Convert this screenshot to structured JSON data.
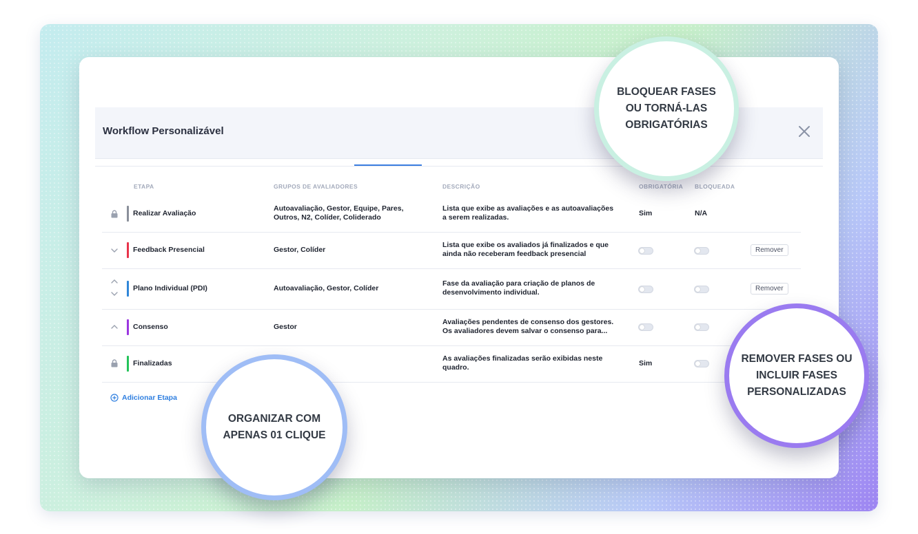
{
  "modal": {
    "title": "Workflow Personalizável"
  },
  "columns": {
    "stage": "ETAPA",
    "groups": "GRUPOS DE AVALIADORES",
    "description": "DESCRIÇÃO",
    "required": "OBRIGATÓRIA",
    "blocked": "BLOQUEADA"
  },
  "rows": [
    {
      "stage": "Realizar Avaliação",
      "groups_1": "Autoavaliação, Gestor, Equipe, Pares,",
      "groups_2": "Outros, N2, Colíder, Coliderado",
      "desc_1": "Lista que exibe as avaliações e as autoavaliações",
      "desc_2": "a serem realizadas.",
      "required": "Sim",
      "blocked": "N/A",
      "color": "#8a8f9a"
    },
    {
      "stage": "Feedback Presencial",
      "groups_1": "Gestor, Colíder",
      "desc_1": "Lista que exibe os avaliados já finalizados e que",
      "desc_2": "ainda não receberam feedback presencial",
      "remove": "Remover",
      "color": "#e8334a"
    },
    {
      "stage": "Plano Individual (PDI)",
      "groups_1": "Autoavaliação, Gestor, Colíder",
      "desc_1": "Fase da avaliação para criação de planos de",
      "desc_2": "desenvolvimento individual.",
      "remove": "Remover",
      "color": "#2f86d8"
    },
    {
      "stage": "Consenso",
      "groups_1": "Gestor",
      "desc_1": "Avaliações pendentes de consenso dos gestores.",
      "desc_2": "Os avaliadores devem salvar o consenso para...",
      "color": "#9b36e0"
    },
    {
      "stage": "Finalizadas",
      "desc_1": "As avaliações finalizadas serão exibidas neste",
      "desc_2": "quadro.",
      "required": "Sim",
      "color": "#24c35a"
    }
  ],
  "add_stage": "Adicionar Etapa",
  "bubbles": {
    "lock": [
      "BLOQUEAR FASES",
      "OU TORNÁ-LAS",
      "OBRIGATÓRIAS"
    ],
    "organize": [
      "ORGANIZAR COM",
      "APENAS 01 CLIQUE"
    ],
    "remove": [
      "REMOVER FASES OU",
      "INCLUIR FASES",
      "PERSONALIZADAS"
    ]
  },
  "colors": {
    "accent": "#3b7de0",
    "bubble_lock_border": "#c9f0e2",
    "bubble_organize_border": "#9fbdf6",
    "bubble_remove_border": "#9a7bf0"
  }
}
